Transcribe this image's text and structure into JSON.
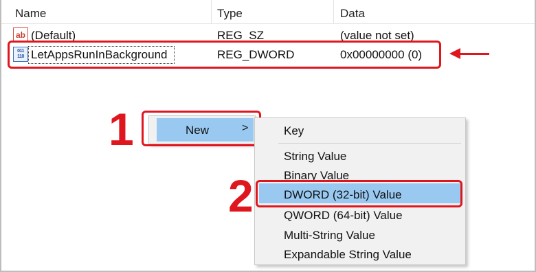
{
  "columns": {
    "name": "Name",
    "type": "Type",
    "data": "Data"
  },
  "rows": [
    {
      "icon": "string-value-icon",
      "icon_text": "ab",
      "name": "(Default)",
      "type": "REG_SZ",
      "data": "(value not set)"
    },
    {
      "icon": "dword-value-icon",
      "icon_text": "011 110",
      "name": "LetAppsRunInBackground",
      "type": "REG_DWORD",
      "data": "0x00000000 (0)"
    }
  ],
  "context_menu": {
    "new_label": "New",
    "submenu_arrow": ">"
  },
  "submenu": {
    "items": [
      "Key",
      "String Value",
      "Binary Value",
      "DWORD (32-bit) Value",
      "QWORD (64-bit) Value",
      "Multi-String Value",
      "Expandable String Value"
    ],
    "highlighted_index": 3
  },
  "annotations": {
    "step1": "1",
    "step2": "2",
    "color": "#e0161e"
  },
  "colors": {
    "menu_highlight": "#99c9f1",
    "menu_background": "#f1f1f1"
  }
}
